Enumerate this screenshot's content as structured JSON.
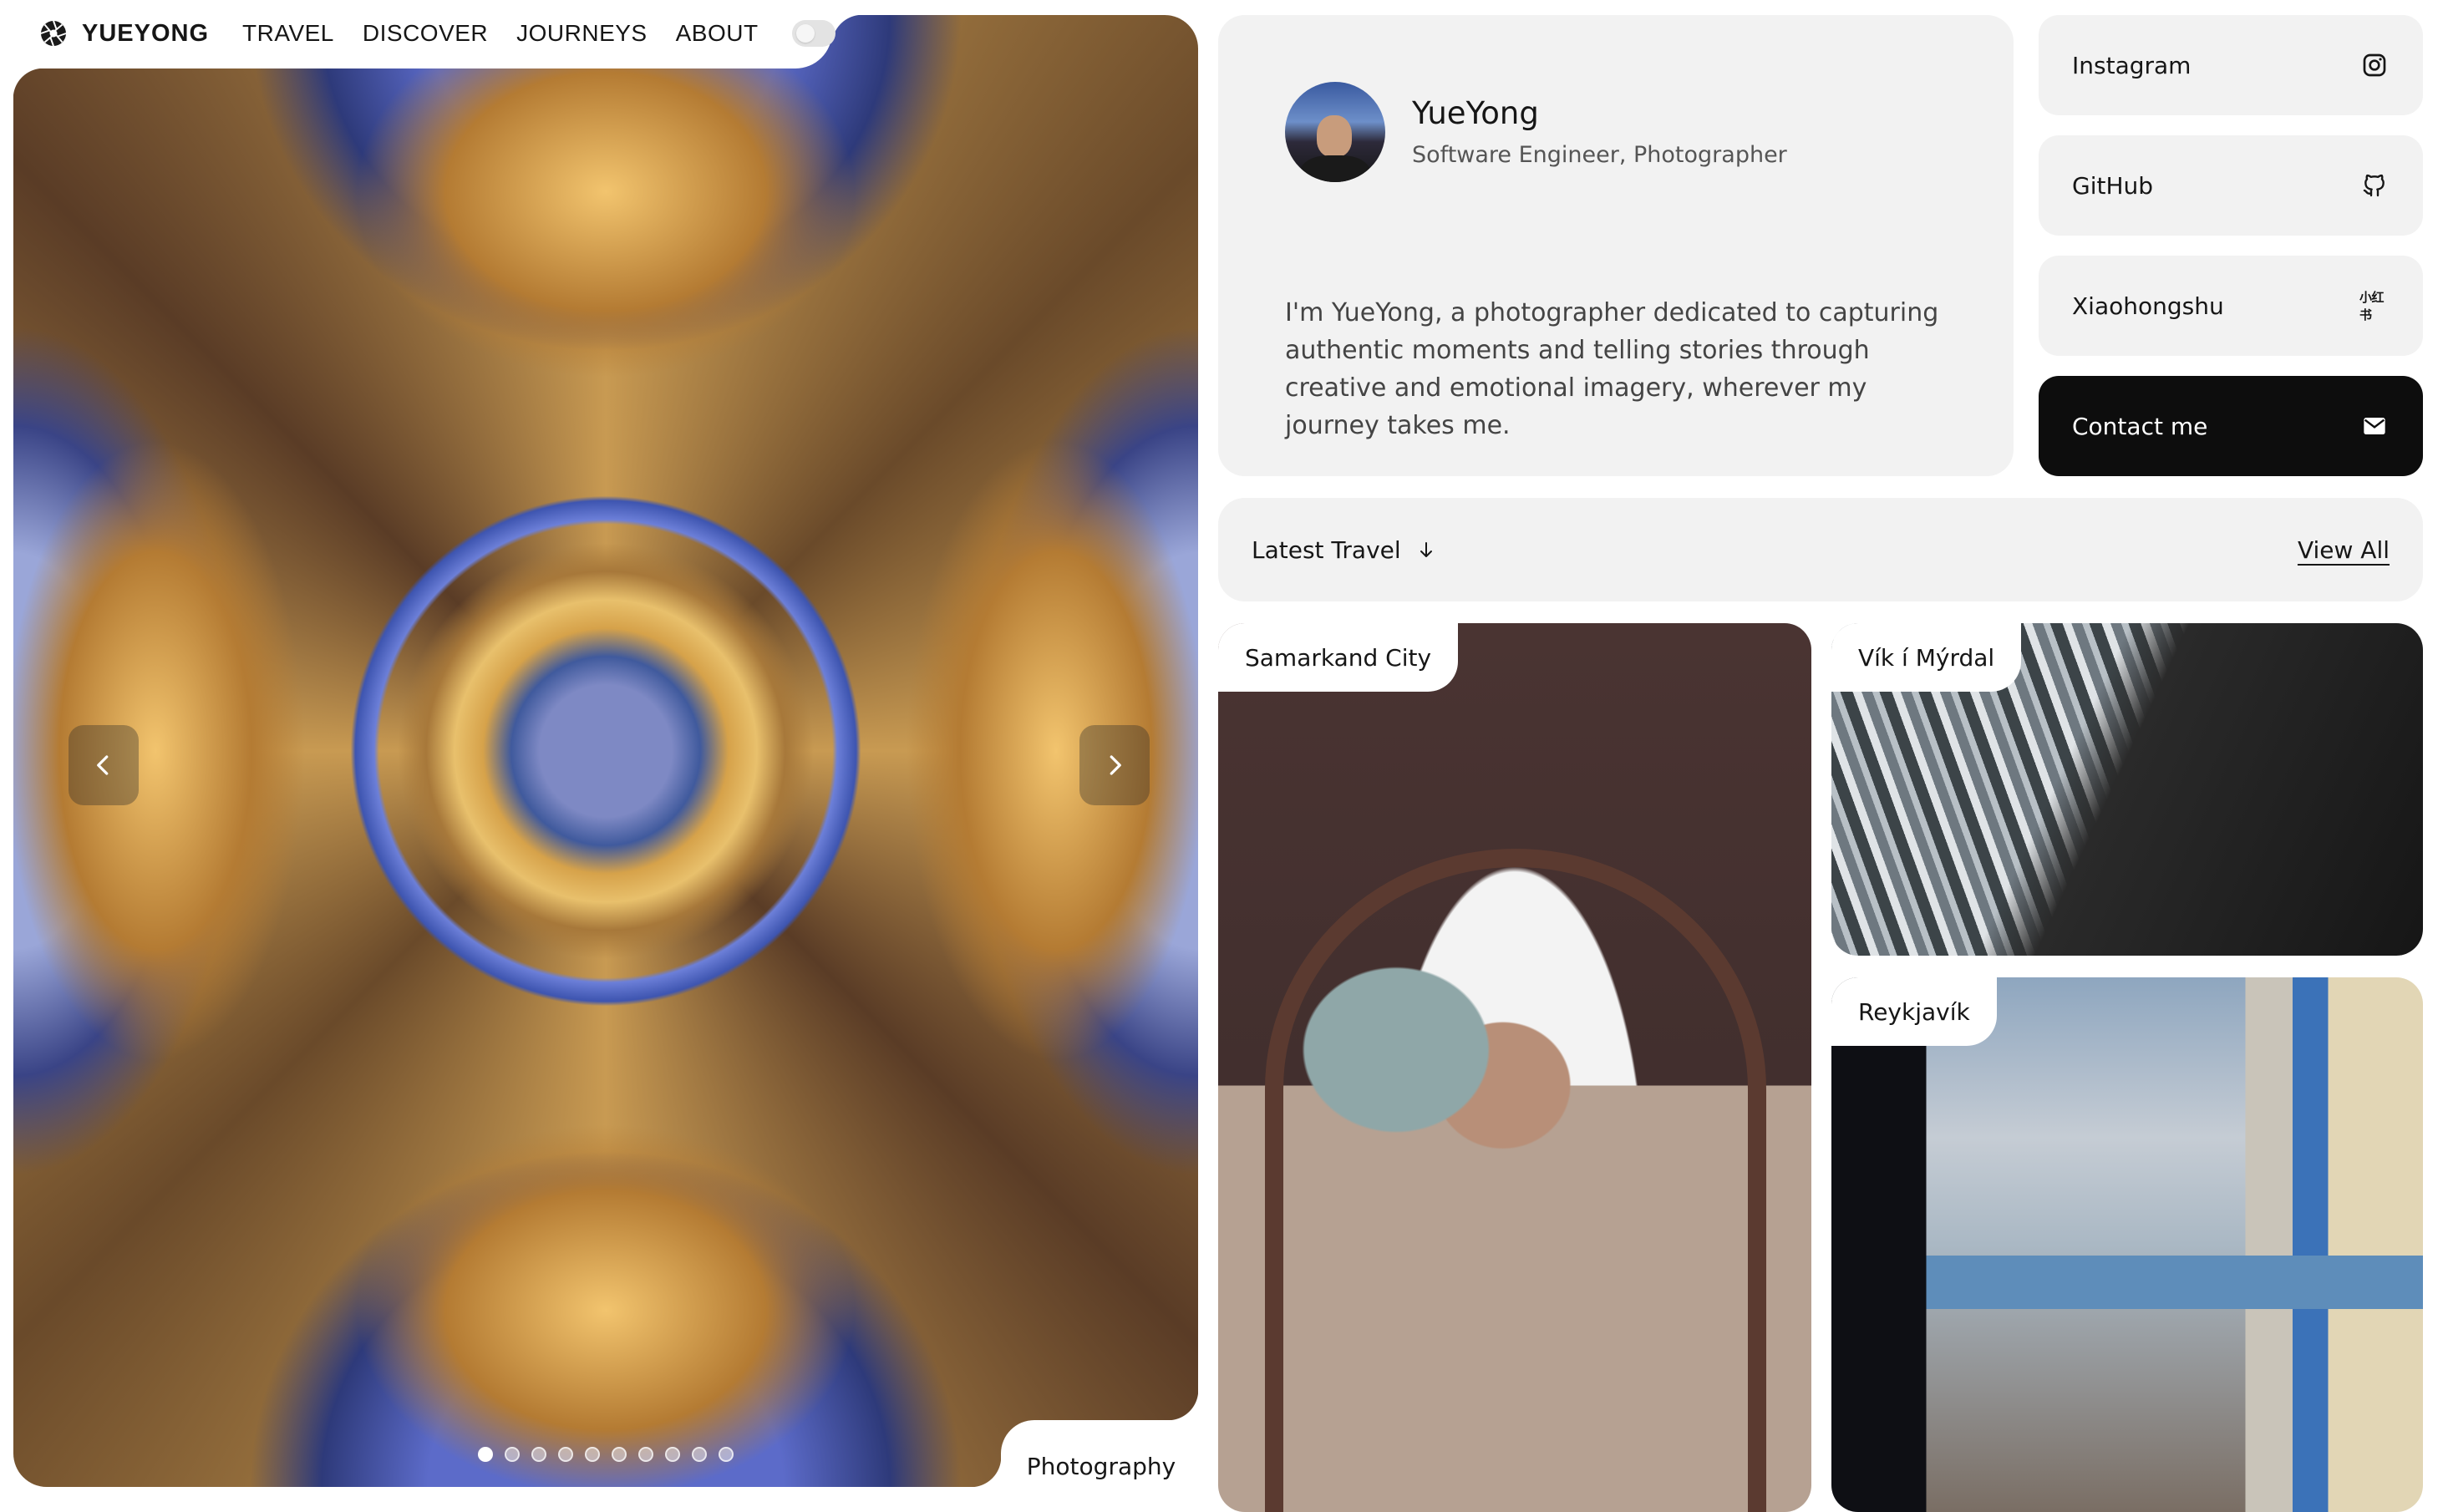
{
  "brand": {
    "name": "YUEYONG"
  },
  "nav": {
    "items": [
      "TRAVEL",
      "DISCOVER",
      "JOURNEYS",
      "ABOUT"
    ]
  },
  "hero": {
    "badge": "Photography",
    "slide_count": 10,
    "active_slide": 1
  },
  "profile": {
    "name": "YueYong",
    "role": "Software Engineer, Photographer",
    "bio": "I'm YueYong, a photographer dedicated to capturing authentic moments and telling stories through creative and emotional imagery, wherever my journey takes me."
  },
  "social": {
    "instagram": "Instagram",
    "github": "GitHub",
    "xiaohongshu": "Xiaohongshu",
    "xiaohongshu_icon_text": "小红书",
    "contact": "Contact me"
  },
  "latest": {
    "title": "Latest Travel",
    "view_all": "View All"
  },
  "travels": [
    {
      "label": "Samarkand City"
    },
    {
      "label": "Vík í Mýrdal"
    },
    {
      "label": "Reykjavík"
    }
  ],
  "colors": {
    "card_bg": "#f2f2f2",
    "contact_bg": "#0d0d0d"
  }
}
